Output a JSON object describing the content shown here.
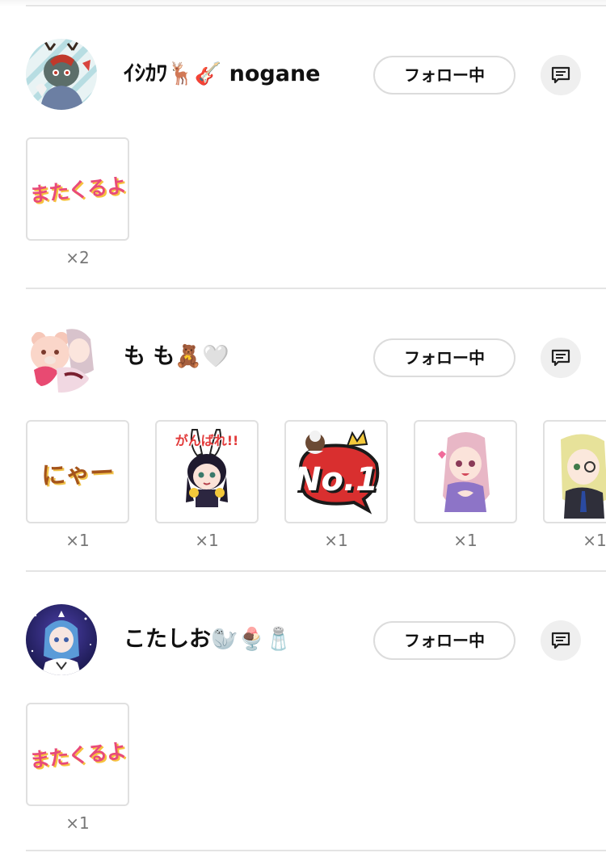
{
  "colors": {
    "divider": "#e4e4e4",
    "follow_border": "#dcdcdc",
    "message_bg": "#efefef",
    "count_text": "#777777"
  },
  "users": [
    {
      "name": "ｲｼｶﾜ🦌🎸 nogane",
      "follow_label": "フォロー中",
      "message_icon": "message-icon",
      "gifts": [
        {
          "sticker": "またくるよ",
          "count": "×2"
        }
      ]
    },
    {
      "name": "も も🧸🤍",
      "follow_label": "フォロー中",
      "message_icon": "message-icon",
      "gifts": [
        {
          "sticker": "にゃー",
          "count": "×1"
        },
        {
          "sticker": "がんばれ!!",
          "count": "×1"
        },
        {
          "sticker": "No.1",
          "count": "×1"
        },
        {
          "sticker": "",
          "count": "×1"
        },
        {
          "sticker": "",
          "count": "×1"
        }
      ]
    },
    {
      "name": "こたしお🦭🍨🧂",
      "follow_label": "フォロー中",
      "message_icon": "message-icon",
      "gifts": [
        {
          "sticker": "またくるよ",
          "count": "×1"
        }
      ]
    }
  ]
}
